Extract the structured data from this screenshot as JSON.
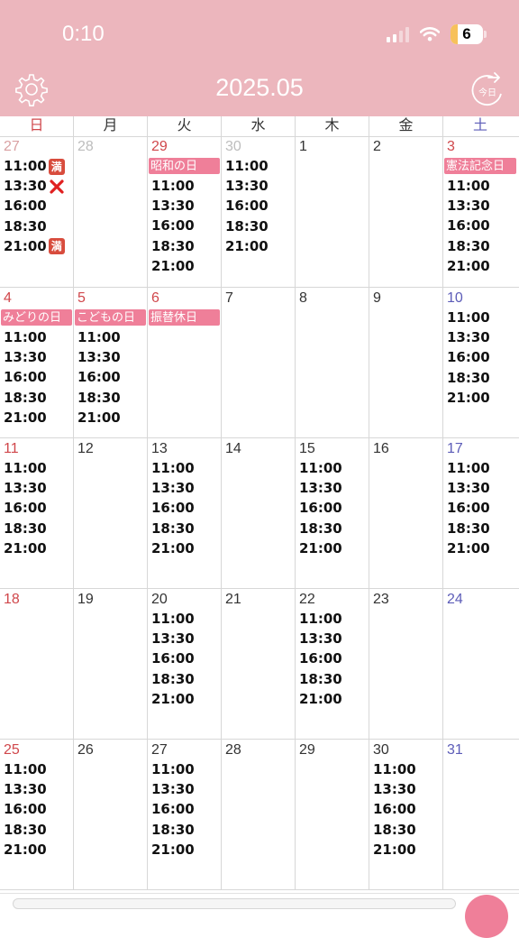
{
  "status": {
    "time": "0:10",
    "battery": "6"
  },
  "header": {
    "title": "2025.05",
    "today_label": "今日"
  },
  "weekdays": [
    "日",
    "月",
    "火",
    "水",
    "木",
    "金",
    "土"
  ],
  "marks": {
    "full": "満"
  },
  "weeks": [
    [
      {
        "date": "27",
        "dim": true,
        "slots": [
          {
            "t": "11:00",
            "mark": "full"
          },
          {
            "t": "13:30",
            "mark": "x"
          },
          {
            "t": "16:00"
          },
          {
            "t": "18:30"
          },
          {
            "t": "21:00",
            "mark": "full"
          }
        ]
      },
      {
        "date": "28",
        "dim": true,
        "slots": []
      },
      {
        "date": "29",
        "dim": true,
        "holiday": "昭和の日",
        "slots": [
          {
            "t": "11:00"
          },
          {
            "t": "13:30"
          },
          {
            "t": "16:00"
          },
          {
            "t": "18:30"
          },
          {
            "t": "21:00"
          }
        ]
      },
      {
        "date": "30",
        "dim": true,
        "slots": [
          {
            "t": "11:00"
          },
          {
            "t": "13:30"
          },
          {
            "t": "16:00"
          },
          {
            "t": "18:30"
          },
          {
            "t": "21:00"
          }
        ]
      },
      {
        "date": "1",
        "slots": []
      },
      {
        "date": "2",
        "slots": []
      },
      {
        "date": "3",
        "holiday": "憲法記念日",
        "slots": [
          {
            "t": "11:00"
          },
          {
            "t": "13:30"
          },
          {
            "t": "16:00"
          },
          {
            "t": "18:30"
          },
          {
            "t": "21:00"
          }
        ]
      }
    ],
    [
      {
        "date": "4",
        "holiday": "みどりの日",
        "slots": [
          {
            "t": "11:00"
          },
          {
            "t": "13:30"
          },
          {
            "t": "16:00"
          },
          {
            "t": "18:30"
          },
          {
            "t": "21:00"
          }
        ]
      },
      {
        "date": "5",
        "holiday": "こどもの日",
        "slots": [
          {
            "t": "11:00"
          },
          {
            "t": "13:30"
          },
          {
            "t": "16:00"
          },
          {
            "t": "18:30"
          },
          {
            "t": "21:00"
          }
        ]
      },
      {
        "date": "6",
        "holiday": "振替休日",
        "slots": []
      },
      {
        "date": "7",
        "slots": []
      },
      {
        "date": "8",
        "slots": []
      },
      {
        "date": "9",
        "slots": []
      },
      {
        "date": "10",
        "slots": [
          {
            "t": "11:00"
          },
          {
            "t": "13:30"
          },
          {
            "t": "16:00"
          },
          {
            "t": "18:30"
          },
          {
            "t": "21:00"
          }
        ]
      }
    ],
    [
      {
        "date": "11",
        "slots": [
          {
            "t": "11:00"
          },
          {
            "t": "13:30"
          },
          {
            "t": "16:00"
          },
          {
            "t": "18:30"
          },
          {
            "t": "21:00"
          }
        ]
      },
      {
        "date": "12",
        "slots": []
      },
      {
        "date": "13",
        "slots": [
          {
            "t": "11:00"
          },
          {
            "t": "13:30"
          },
          {
            "t": "16:00"
          },
          {
            "t": "18:30"
          },
          {
            "t": "21:00"
          }
        ]
      },
      {
        "date": "14",
        "slots": []
      },
      {
        "date": "15",
        "slots": [
          {
            "t": "11:00"
          },
          {
            "t": "13:30"
          },
          {
            "t": "16:00"
          },
          {
            "t": "18:30"
          },
          {
            "t": "21:00"
          }
        ]
      },
      {
        "date": "16",
        "slots": []
      },
      {
        "date": "17",
        "slots": [
          {
            "t": "11:00"
          },
          {
            "t": "13:30"
          },
          {
            "t": "16:00"
          },
          {
            "t": "18:30"
          },
          {
            "t": "21:00"
          }
        ]
      }
    ],
    [
      {
        "date": "18",
        "slots": []
      },
      {
        "date": "19",
        "slots": []
      },
      {
        "date": "20",
        "slots": [
          {
            "t": "11:00"
          },
          {
            "t": "13:30"
          },
          {
            "t": "16:00"
          },
          {
            "t": "18:30"
          },
          {
            "t": "21:00"
          }
        ]
      },
      {
        "date": "21",
        "slots": []
      },
      {
        "date": "22",
        "slots": [
          {
            "t": "11:00"
          },
          {
            "t": "13:30"
          },
          {
            "t": "16:00"
          },
          {
            "t": "18:30"
          },
          {
            "t": "21:00"
          }
        ]
      },
      {
        "date": "23",
        "slots": []
      },
      {
        "date": "24",
        "slots": []
      }
    ],
    [
      {
        "date": "25",
        "slots": [
          {
            "t": "11:00"
          },
          {
            "t": "13:30"
          },
          {
            "t": "16:00"
          },
          {
            "t": "18:30"
          },
          {
            "t": "21:00"
          }
        ]
      },
      {
        "date": "26",
        "slots": []
      },
      {
        "date": "27",
        "slots": [
          {
            "t": "11:00"
          },
          {
            "t": "13:30"
          },
          {
            "t": "16:00"
          },
          {
            "t": "18:30"
          },
          {
            "t": "21:00"
          }
        ]
      },
      {
        "date": "28",
        "slots": []
      },
      {
        "date": "29",
        "slots": []
      },
      {
        "date": "30",
        "slots": [
          {
            "t": "11:00"
          },
          {
            "t": "13:30"
          },
          {
            "t": "16:00"
          },
          {
            "t": "18:30"
          },
          {
            "t": "21:00"
          }
        ]
      },
      {
        "date": "31",
        "slots": []
      }
    ]
  ],
  "colors": {
    "header_bg": "#ecb6bd",
    "holiday_bg": "#ef7f99",
    "sunday": "#d0474b",
    "saturday": "#5c5cb8",
    "full_mark": "#d84c3d",
    "x_mark": "#e02020"
  }
}
